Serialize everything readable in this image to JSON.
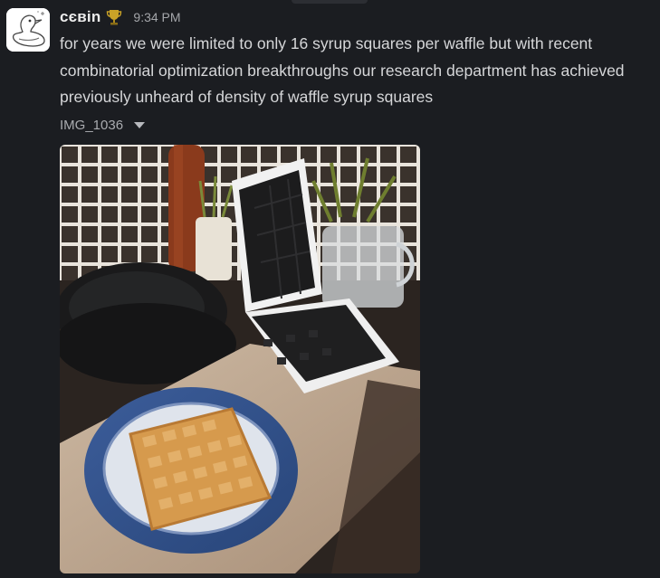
{
  "message": {
    "author": "сєвіn",
    "badge_icon": "trophy-icon",
    "timestamp": "9:34 PM",
    "text": "for years we were limited to only 16 syrup squares per waffle but with recent combinatorial optimization breakthroughs our research department has achieved previously unheard of density of waffle syrup squares",
    "attachment": {
      "filename": "IMG_1036",
      "toggle_icon": "caret-down-icon"
    }
  },
  "colors": {
    "background": "#1b1d21",
    "text": "#d6d7d9",
    "muted": "#a4a6aa",
    "username": "#ececec",
    "trophy": "#c9a227"
  }
}
